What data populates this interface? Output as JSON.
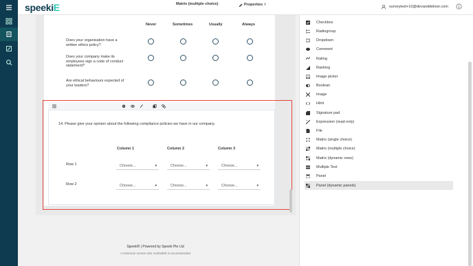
{
  "app": {
    "logo_main": "speeki",
    "logo_accent": "E"
  },
  "user": {
    "email": "surveytest+10@devanddeliver.com"
  },
  "survey": {
    "columns": [
      "Never",
      "Sometimes",
      "Usually",
      "Always"
    ],
    "questions": [
      "Does your organisation have a written ethics policy?",
      "Does your company make its employees sign a code of conduct statement?",
      "Are ethical behaviours expected of your leaders?"
    ]
  },
  "selected_question": {
    "toolbar_title": "Matrix (multiple choice)",
    "properties_label": "Properties",
    "title": "14.  Please give your opinion about the following compliance policies we have in our company.",
    "columns": [
      "Column 1",
      "Column 2",
      "Column 3"
    ],
    "rows": [
      "Row 1",
      "Row 2"
    ],
    "dropdown_placeholder": "Choose..."
  },
  "toolbox": {
    "items": [
      {
        "label": "Checkbox",
        "icon": "checkbox-icon"
      },
      {
        "label": "Radiogroup",
        "icon": "radiogroup-icon"
      },
      {
        "label": "Dropdown",
        "icon": "dropdown-icon"
      },
      {
        "label": "Comment",
        "icon": "comment-icon"
      },
      {
        "label": "Rating",
        "icon": "rating-icon"
      },
      {
        "label": "Ranking",
        "icon": "ranking-icon"
      },
      {
        "label": "Image picker",
        "icon": "image-picker-icon"
      },
      {
        "label": "Boolean",
        "icon": "boolean-icon"
      },
      {
        "label": "Image",
        "icon": "image-icon"
      },
      {
        "label": "Html",
        "icon": "html-icon"
      },
      {
        "label": "Signature pad",
        "icon": "signature-icon"
      },
      {
        "label": "Expression (read-only)",
        "icon": "expression-icon"
      },
      {
        "label": "File",
        "icon": "file-icon"
      },
      {
        "label": "Matrix (single choice)",
        "icon": "matrix-single-icon"
      },
      {
        "label": "Matrix (multiple choice)",
        "icon": "matrix-multiple-icon"
      },
      {
        "label": "Matrix (dynamic rows)",
        "icon": "matrix-dynamic-icon"
      },
      {
        "label": "Multiple Text",
        "icon": "multiple-text-icon"
      },
      {
        "label": "Panel",
        "icon": "panel-icon"
      },
      {
        "label": "Panel (dynamic panels)",
        "icon": "panel-dynamic-icon"
      }
    ]
  },
  "footer": {
    "line1": "Speeki®  |  Powered by Speeki Pte Ltd",
    "line2": "A minimum screen size 1440x900 is recommended"
  },
  "colors": {
    "sidebar": "#0e3b4f",
    "accent": "#2ec4b6",
    "selection_border": "#e0443a"
  }
}
